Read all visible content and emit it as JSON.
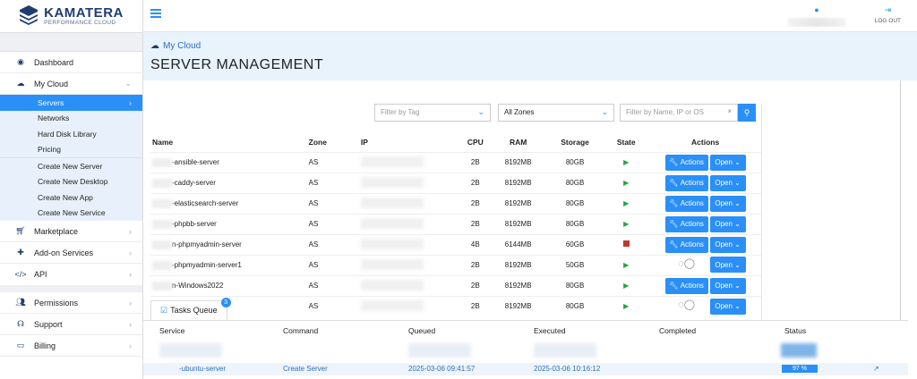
{
  "brand": {
    "name": "KAMATERA",
    "tagline": "PERFORMANCE CLOUD"
  },
  "topbar": {
    "logout_label": "LOG OUT"
  },
  "breadcrumb": "My Cloud",
  "page_title": "SERVER MANAGEMENT",
  "sidebar": {
    "items": [
      {
        "label": "Dashboard",
        "icon": "dashboard-icon"
      },
      {
        "label": "My Cloud",
        "icon": "cloud-icon"
      }
    ],
    "subitems": [
      {
        "label": "Servers"
      },
      {
        "label": "Networks"
      },
      {
        "label": "Hard Disk Library"
      },
      {
        "label": "Pricing"
      },
      {
        "label": "Create New Server"
      },
      {
        "label": "Create New Desktop"
      },
      {
        "label": "Create New App"
      },
      {
        "label": "Create New Service"
      }
    ],
    "items2": [
      {
        "label": "Marketplace",
        "icon": "cart-icon"
      },
      {
        "label": "Add-on Services",
        "icon": "puzzle-icon"
      },
      {
        "label": "API",
        "icon": "code-icon"
      },
      {
        "label": "Permissions",
        "icon": "users-icon"
      },
      {
        "label": "Support",
        "icon": "headset-icon"
      },
      {
        "label": "Billing",
        "icon": "card-icon"
      }
    ]
  },
  "filters": {
    "tag_placeholder": "Filter by Tag",
    "zone_value": "All Zones",
    "search_placeholder": "Filter by Name, IP or OS"
  },
  "table": {
    "headers": {
      "name": "Name",
      "zone": "Zone",
      "ip": "IP",
      "cpu": "CPU",
      "ram": "RAM",
      "storage": "Storage",
      "state": "State",
      "actions": "Actions"
    },
    "rows": [
      {
        "name": "-ansible-server",
        "zone": "AS",
        "cpu": "2B",
        "ram": "8192MB",
        "storage": "80GB",
        "state": "running"
      },
      {
        "name": "-caddy-server",
        "zone": "AS",
        "cpu": "2B",
        "ram": "8192MB",
        "storage": "80GB",
        "state": "running"
      },
      {
        "name": "-elasticsearch-server",
        "zone": "AS",
        "cpu": "2B",
        "ram": "8192MB",
        "storage": "80GB",
        "state": "running"
      },
      {
        "name": "-phpbb-server",
        "zone": "AS",
        "cpu": "2B",
        "ram": "8192MB",
        "storage": "80GB",
        "state": "running"
      },
      {
        "name": "n-phpmyadmin-server",
        "zone": "AS",
        "cpu": "4B",
        "ram": "6144MB",
        "storage": "60GB",
        "state": "stopped"
      },
      {
        "name": "-phpmyadmin-server1",
        "zone": "AS",
        "cpu": "2B",
        "ram": "8192MB",
        "storage": "50GB",
        "state": "running"
      },
      {
        "name": "n-Windows2022",
        "zone": "AS",
        "cpu": "2B",
        "ram": "8192MB",
        "storage": "80GB",
        "state": "running"
      },
      {
        "name": "",
        "zone": "AS",
        "cpu": "2B",
        "ram": "8192MB",
        "storage": "80GB",
        "state": "running"
      }
    ],
    "actions_label": "Actions",
    "open_label": "Open"
  },
  "tasks": {
    "tab_label": "Tasks Queue",
    "badge": "3",
    "headers": {
      "service": "Service",
      "command": "Command",
      "queued": "Queued",
      "executed": "Executed",
      "completed": "Completed",
      "status": "Status"
    },
    "row": {
      "service": "-ubuntu-server",
      "command": "Create Server",
      "queued": "2025-03-06 09:41:57",
      "executed": "2025-03-06 10:16:12",
      "progress_label": "97 %",
      "progress": 0.97
    }
  },
  "colors": {
    "accent": "#2a8ff7",
    "brand": "#1f3d70",
    "running": "#23a443",
    "stopped": "#c0392b"
  }
}
